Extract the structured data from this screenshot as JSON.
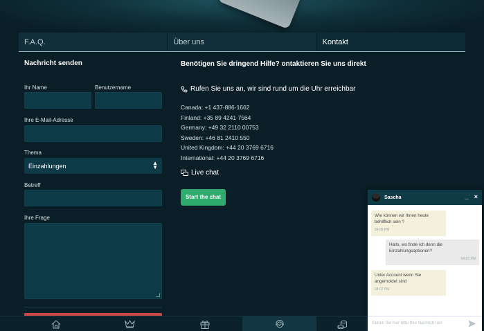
{
  "tabs": [
    {
      "label": "F.A.Q.",
      "active": false
    },
    {
      "label": "Über uns",
      "active": false
    },
    {
      "label": "Kontakt",
      "active": true
    }
  ],
  "form": {
    "title": "Nachricht senden",
    "name_label": "Ihr Name",
    "username_label": "Benutzername",
    "email_label": "Ihre E-Mail-Adresse",
    "topic_label": "Thema",
    "topic_value": "Einzahlungen",
    "subject_label": "Betreff",
    "question_label": "Ihre Frage"
  },
  "contact": {
    "title": "Benötigen Sie dringend Hilfe? ontaktieren Sie uns direkt",
    "phone_heading": "Rufen Sie uns an, wir sind rund um die Uhr erreichbar",
    "numbers": [
      "Canada: +1 437-886-1662",
      "Finland: +35 89 4241 7564",
      "Germany: +49 32 2110 00753",
      "Sweden: +46 81 2410 550",
      "United Kingdom: +44 20 3769 6716",
      "International: +44 20 3769 6716"
    ],
    "livechat_label": "Live chat",
    "start_button": "Start the chat"
  },
  "chat": {
    "agent_name": "Sascha",
    "minimize": "_",
    "close": "×",
    "messages": [
      {
        "from": "agent",
        "text": "Wie können wir Ihnen heute behilflich sein ?",
        "time": "04:05 PM"
      },
      {
        "from": "user",
        "text": "Hallo, wo finde ich denn die Einzahlungsoptionen?",
        "time": "04:07 PM"
      },
      {
        "from": "agent",
        "text": "Unter Account wenn Sie angemoldet sind",
        "time": "04:07 PM"
      }
    ],
    "input_placeholder": "Geben Sie hier bitte Ihre Nachricht ein"
  },
  "colors": {
    "background": "#0a1e27",
    "field": "#0c3a46",
    "accent_green": "#2fab6e",
    "accent_red": "#c94848",
    "chat_header": "#0f3b47"
  },
  "bottom_nav": [
    {
      "icon": "home-icon",
      "active": false
    },
    {
      "icon": "crown-icon",
      "active": false
    },
    {
      "icon": "gift-icon",
      "active": false
    },
    {
      "icon": "support-icon",
      "active": true
    },
    {
      "icon": "coins-icon",
      "active": false
    }
  ]
}
